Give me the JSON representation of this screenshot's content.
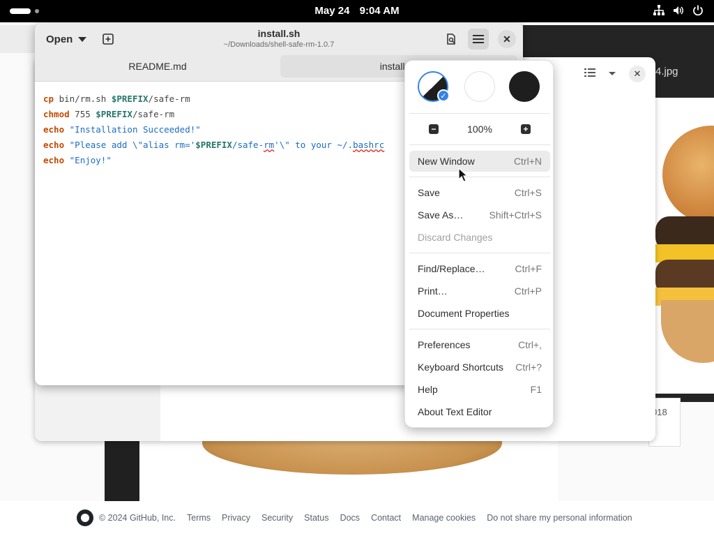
{
  "topbar": {
    "date": "May 24",
    "time": "9:04 AM",
    "icons": [
      "network-icon",
      "volume-icon",
      "power-icon"
    ]
  },
  "footer": {
    "copyright": "© 2024 GitHub, Inc.",
    "links": [
      "Terms",
      "Privacy",
      "Security",
      "Status",
      "Docs",
      "Contact",
      "Manage cookies",
      "Do not share my personal information"
    ]
  },
  "background": {
    "image_title": "4.jpg",
    "right_tail_text": "018"
  },
  "editor": {
    "open_label": "Open",
    "title": "install.sh",
    "subtitle": "~/Downloads/shell-safe-rm-1.0.7",
    "tabs": [
      "README.md",
      "install.sh"
    ]
  },
  "menu": {
    "zoom": "100%",
    "items": [
      {
        "label": "New Window",
        "shortcut": "Ctrl+N"
      },
      {
        "label": "Save",
        "shortcut": "Ctrl+S"
      },
      {
        "label": "Save As…",
        "shortcut": "Shift+Ctrl+S"
      },
      {
        "label": "Discard Changes",
        "shortcut": ""
      },
      {
        "label": "Find/Replace…",
        "shortcut": "Ctrl+F"
      },
      {
        "label": "Print…",
        "shortcut": "Ctrl+P"
      },
      {
        "label": "Document Properties",
        "shortcut": ""
      },
      {
        "label": "Preferences",
        "shortcut": "Ctrl+,"
      },
      {
        "label": "Keyboard Shortcuts",
        "shortcut": "Ctrl+?"
      },
      {
        "label": "Help",
        "shortcut": "F1"
      },
      {
        "label": "About Text Editor",
        "shortcut": ""
      }
    ]
  },
  "colors": {
    "accent": "#3584e4",
    "keyword": "#c14b00",
    "variable": "#26766a",
    "string": "#1c6dc6"
  }
}
